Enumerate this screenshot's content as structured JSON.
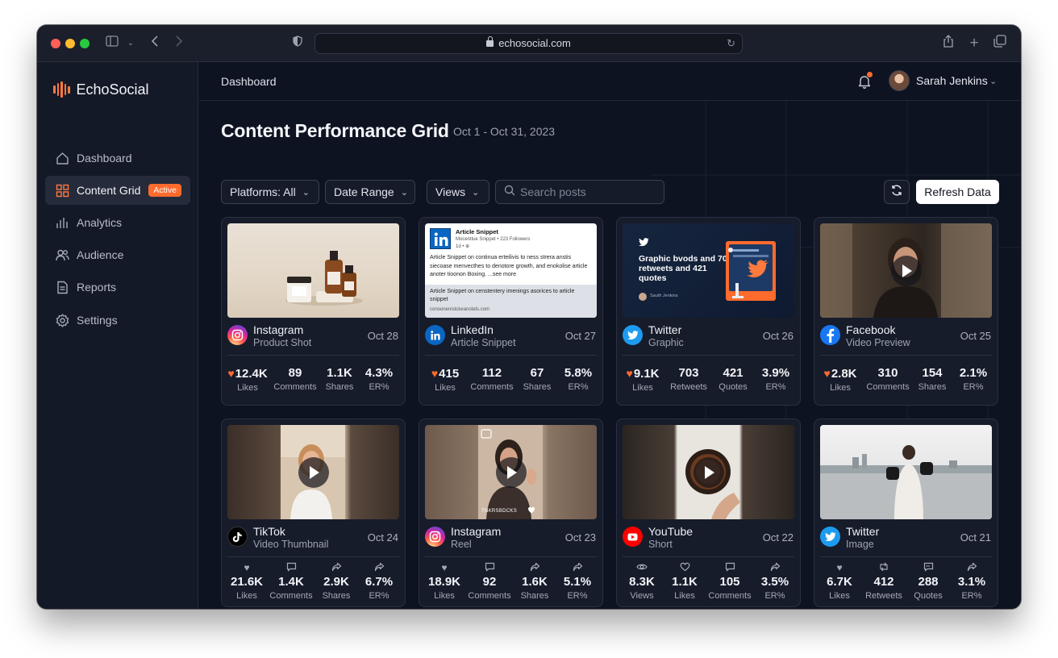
{
  "browser": {
    "url": "echosocial.com"
  },
  "app": {
    "name": "EchoSocial"
  },
  "sidebar": {
    "items": [
      {
        "label": "Dashboard",
        "icon": "home-icon"
      },
      {
        "label": "Content Grid",
        "icon": "grid-icon",
        "badge": "Active",
        "active": true
      },
      {
        "label": "Analytics",
        "icon": "bar-chart-icon"
      },
      {
        "label": "Audience",
        "icon": "users-icon"
      },
      {
        "label": "Reports",
        "icon": "document-icon"
      },
      {
        "label": "Settings",
        "icon": "gear-icon"
      }
    ]
  },
  "header": {
    "breadcrumb": "Dashboard",
    "user": "Sarah Jenkins"
  },
  "page": {
    "title": "Content Performance Grid",
    "date_range": "Oct 1 - Oct 31, 2023"
  },
  "filters": {
    "platforms": "Platforms: All",
    "date_range": "Date Range",
    "views": "Views",
    "search_placeholder": "Search posts",
    "refresh": "Refresh Data"
  },
  "colors": {
    "accent": "#ff6b2c",
    "bg": "#0e1322",
    "card": "#171c2b"
  },
  "cards": [
    {
      "platform": "Instagram",
      "type": "Product Shot",
      "date": "Oct 28",
      "stats": [
        {
          "value": "12.4K",
          "label": "Likes"
        },
        {
          "value": "89",
          "label": "Comments"
        },
        {
          "value": "1.1K",
          "label": "Shares"
        },
        {
          "value": "4.3%",
          "label": "ER%"
        }
      ]
    },
    {
      "platform": "LinkedIn",
      "type": "Article Snippet",
      "date": "Oct 27",
      "thumb_text": {
        "title": "Article Snippet",
        "meta": "Mocentlue Snippet • 223 Followers",
        "time": "1d • ⊕",
        "body": "Article Snippet on continua erteilivis to ness strera anstis siecoase menvecthes to denotore growth, and enokolise article anoter tioonon Boxing. ...see more",
        "footer_title": "Article Snippet on censtentery imenings asorices to article snippet",
        "footer_url": "conoonenistckeanotels.com"
      },
      "stats": [
        {
          "value": "415",
          "label": "Likes"
        },
        {
          "value": "112",
          "label": "Comments"
        },
        {
          "value": "67",
          "label": "Shares"
        },
        {
          "value": "5.8%",
          "label": "ER%"
        }
      ]
    },
    {
      "platform": "Twitter",
      "type": "Graphic",
      "date": "Oct 26",
      "thumb_text": {
        "headline": "Graphic bvods and 702 retweets and 421 quotes",
        "author": "Sauth Jenkins"
      },
      "stats": [
        {
          "value": "9.1K",
          "label": "Likes"
        },
        {
          "value": "703",
          "label": "Retweets"
        },
        {
          "value": "421",
          "label": "Quotes"
        },
        {
          "value": "3.9%",
          "label": "ER%"
        }
      ]
    },
    {
      "platform": "Facebook",
      "type": "Video Preview",
      "date": "Oct 25",
      "stats": [
        {
          "value": "2.8K",
          "label": "Likes"
        },
        {
          "value": "310",
          "label": "Comments"
        },
        {
          "value": "154",
          "label": "Shares"
        },
        {
          "value": "2.1%",
          "label": "ER%"
        }
      ]
    },
    {
      "platform": "TikTok",
      "type": "Video Thumbnail",
      "date": "Oct 24",
      "stats": [
        {
          "value": "21.6K",
          "label": "Likes",
          "icon": "heart-icon"
        },
        {
          "value": "1.4K",
          "label": "Comments",
          "icon": "comment-icon"
        },
        {
          "value": "2.9K",
          "label": "Shares",
          "icon": "share-icon"
        },
        {
          "value": "6.7%",
          "label": "ER%",
          "icon": "share-icon"
        }
      ]
    },
    {
      "platform": "Instagram",
      "type": "Reel",
      "date": "Oct 23",
      "thumb_text": {
        "caption": "TNKRSBDCKS"
      },
      "stats": [
        {
          "value": "18.9K",
          "label": "Likes",
          "icon": "heart-icon"
        },
        {
          "value": "92",
          "label": "Comments",
          "icon": "comment-icon"
        },
        {
          "value": "1.6K",
          "label": "Shares",
          "icon": "share-icon"
        },
        {
          "value": "5.1%",
          "label": "ER%",
          "icon": "share-icon"
        }
      ]
    },
    {
      "platform": "YouTube",
      "type": "Short",
      "date": "Oct 22",
      "stats": [
        {
          "value": "8.3K",
          "label": "Views",
          "icon": "eye-icon"
        },
        {
          "value": "1.1K",
          "label": "Likes",
          "icon": "heart-outline-icon"
        },
        {
          "value": "105",
          "label": "Comments",
          "icon": "comment-icon"
        },
        {
          "value": "3.5%",
          "label": "ER%",
          "icon": "share-icon"
        }
      ]
    },
    {
      "platform": "Twitter",
      "type": "Image",
      "date": "Oct 21",
      "stats": [
        {
          "value": "6.7K",
          "label": "Likes",
          "icon": "heart-icon"
        },
        {
          "value": "412",
          "label": "Retweets",
          "icon": "retweet-icon"
        },
        {
          "value": "288",
          "label": "Quotes",
          "icon": "quote-icon"
        },
        {
          "value": "3.1%",
          "label": "ER%",
          "icon": "share-icon"
        }
      ]
    }
  ]
}
